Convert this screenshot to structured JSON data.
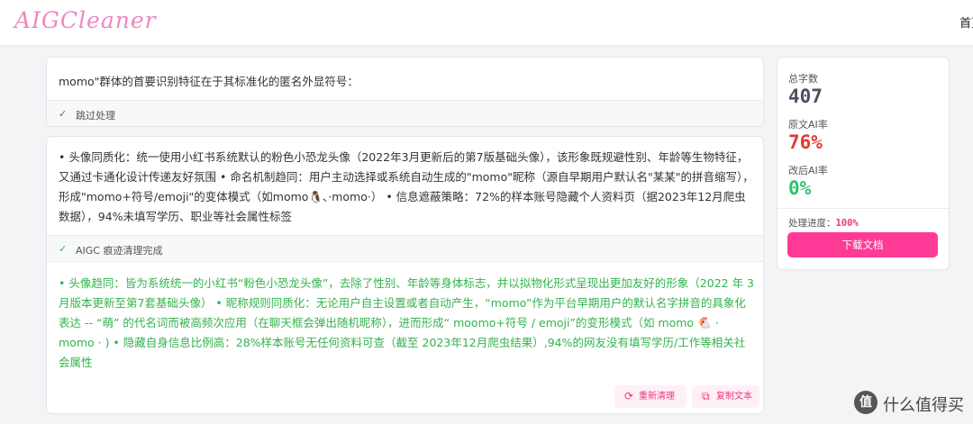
{
  "header": {
    "logo": "AIGCleaner",
    "nav_home": "首页"
  },
  "original_card": {
    "text": "momo\"群体的首要识别特征在于其标准化的匿名外显符号：",
    "status": "跳过处理"
  },
  "process_card": {
    "original_text": "• 头像同质化：统一使用小红书系统默认的粉色小恐龙头像（2022年3月更新后的第7版基础头像），该形象既规避性别、年龄等生物特征，又通过卡通化设计传递友好氛围 • 命名机制趋同：用户主动选择或系统自动生成的\"momo\"昵称（源自早期用户默认名\"某某\"的拼音缩写），形成\"momo+符号/emoji\"的变体模式（如momo🐧、·momo·） • 信息遮蔽策略：72%的样本账号隐藏个人资料页（据2023年12月爬虫数据），94%未填写学历、职业等社会属性标签",
    "status": "AIGC 痕迹清理完成",
    "result_text": "• 头像趋同：皆为系统统一的小红书“粉色小恐龙头像”，去除了性别、年龄等身体标志，并以拟物化形式呈现出更加友好的形象（2022 年 3 月版本更新至第7套基础头像） • 昵称规则同质化：无论用户自主设置或者自动产生，“momo”作为平台早期用户的默认名字拼音的具象化表达 -- “萌” 的代名词而被高频次应用（在聊天框会弹出随机昵称），进而形成“ moomo+符号 / emoji”的变形模式（如 momo 🐔 · momo · ) • 隐藏自身信息比例高：28%样本账号无任何资料可查（截至 2023年12月爬虫结果）,94%的网友没有填写学历/工作等相关社会属性",
    "reclean_label": "重新清理",
    "copy_label": "复制文本"
  },
  "stats": {
    "total_label": "总字数",
    "total_value": "407",
    "orig_ai_label": "原文AI率",
    "orig_ai_value": "76%",
    "after_ai_label": "改后AI率",
    "after_ai_value": "0%",
    "progress_label": "处理进度：",
    "progress_value": "100%",
    "download_label": "下载文档"
  },
  "watermark": {
    "icon_glyph": "值",
    "text": "什么值得买"
  },
  "icons": {
    "check": "check-icon",
    "refresh": "refresh-icon",
    "copy": "copy-icon"
  },
  "colors": {
    "accent": "#ff3b97",
    "orig_ai": "#e53935",
    "after_ai": "#31c06b",
    "result_text": "#33b34d"
  }
}
